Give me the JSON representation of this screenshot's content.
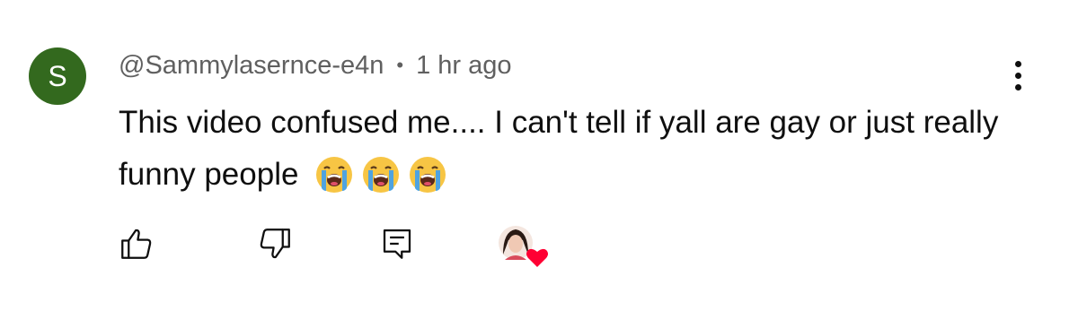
{
  "comment": {
    "avatar_letter": "S",
    "avatar_color": "#33691e",
    "username": "@Sammylasernce-e4n",
    "separator": "•",
    "timestamp": "1 hr ago",
    "text": "This video confused me.... I can't tell if yall are gay or just really funny people",
    "emojis": [
      "loudly-crying-face",
      "loudly-crying-face",
      "loudly-crying-face"
    ]
  },
  "actions": {
    "like_icon": "thumbs-up-icon",
    "dislike_icon": "thumbs-down-icon",
    "reply_icon": "comment-reply-icon",
    "creator_heart_icon": "creator-heart-icon",
    "heart_color": "#ff0033"
  },
  "menu_icon": "more-vertical-icon"
}
